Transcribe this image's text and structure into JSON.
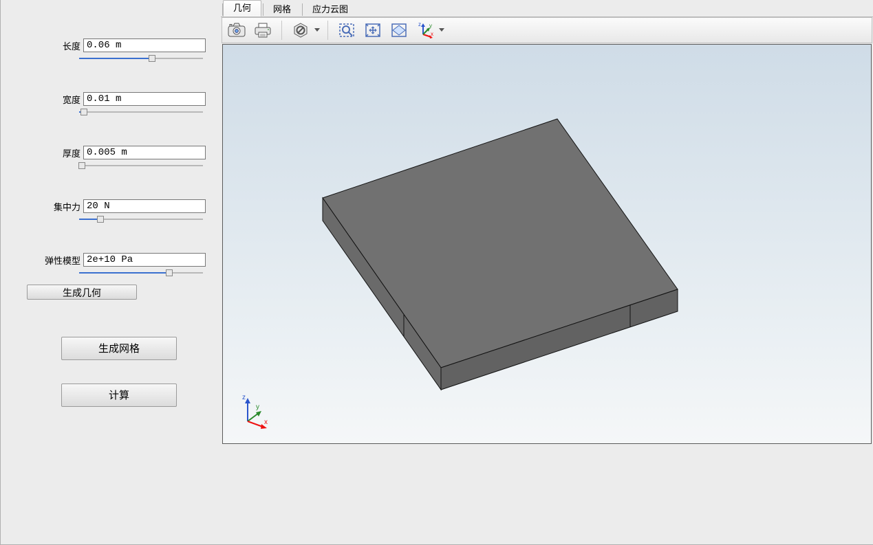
{
  "sidebar": {
    "params": [
      {
        "label": "长度",
        "value": "0.06 m",
        "ratio": 0.59
      },
      {
        "label": "宽度",
        "value": "0.01 m",
        "ratio": 0.04
      },
      {
        "label": "厚度",
        "value": "0.005 m",
        "ratio": 0.02
      },
      {
        "label": "集中力",
        "value": "20 N",
        "ratio": 0.17
      },
      {
        "label": "弹性模型",
        "value": "2e+10 Pa",
        "ratio": 0.73
      }
    ],
    "buttons": {
      "generate_geometry": "生成几何",
      "generate_mesh": "生成网格",
      "compute": "计算"
    }
  },
  "tabs": [
    {
      "label": "几何",
      "active": true
    },
    {
      "label": "网格",
      "active": false
    },
    {
      "label": "应力云图",
      "active": false
    }
  ],
  "toolbar": {
    "items": {
      "snapshot": "snapshot-icon",
      "print": "print-icon",
      "cancel": "cancel-icon",
      "zoom_box": "zoom-box-icon",
      "zoom_extents": "zoom-extents-icon",
      "zoom_selected": "zoom-selected-icon",
      "orientation": "orientation-axes-icon"
    }
  },
  "triad": {
    "x": "x",
    "y": "y",
    "z": "z",
    "colors": {
      "x": "#e11",
      "y": "#2b8a2b",
      "z": "#2a55cc"
    }
  },
  "geometry": {
    "fill_top": "#717171",
    "fill_front": "#6a6a6a",
    "fill_side": "#626262",
    "stroke": "#111"
  }
}
